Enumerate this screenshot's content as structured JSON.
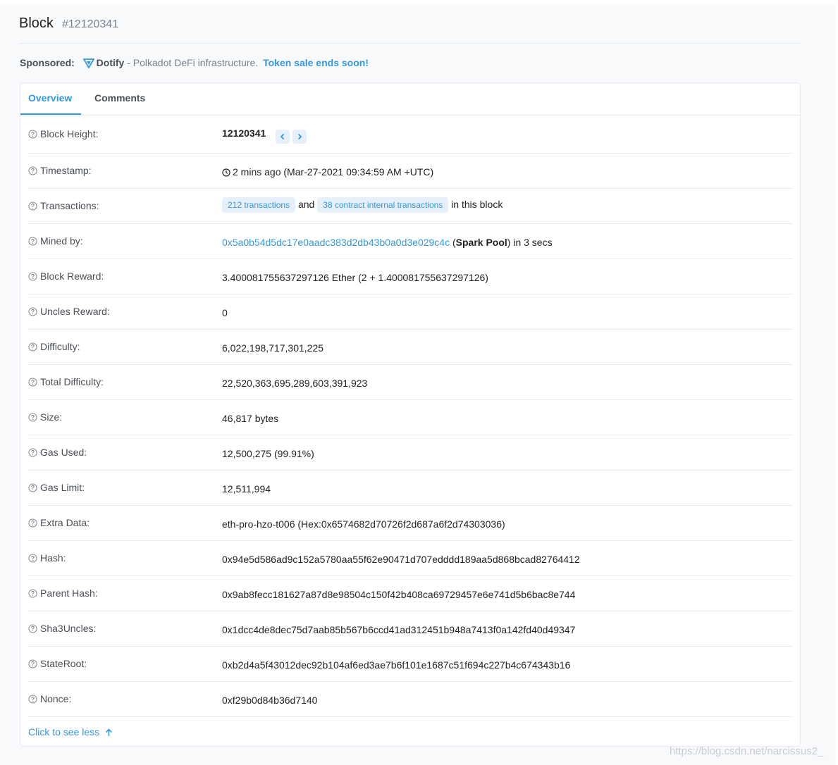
{
  "header": {
    "title": "Block",
    "block_number": "#12120341"
  },
  "sponsor": {
    "label": "Sponsored:",
    "brand": "Dotify",
    "text": "- Polkadot DeFi infrastructure.",
    "cta": "Token sale ends soon!"
  },
  "tabs": [
    {
      "label": "Overview",
      "active": true
    },
    {
      "label": "Comments",
      "active": false
    }
  ],
  "overview": {
    "block_height": {
      "label": "Block Height:",
      "value": "12120341"
    },
    "timestamp": {
      "label": "Timestamp:",
      "value": "2 mins ago (Mar-27-2021 09:34:59 AM +UTC)"
    },
    "transactions": {
      "label": "Transactions:",
      "tx_badge": "212 transactions",
      "and": "and",
      "internal_badge": "38 contract internal transactions",
      "suffix": "in this block"
    },
    "mined_by": {
      "label": "Mined by:",
      "address": "0x5a0b54d5dc17e0aadc383d2db43b0a0d3e029c4c",
      "open_paren": "(",
      "pool": "Spark Pool",
      "suffix": ") in 3 secs"
    },
    "block_reward": {
      "label": "Block Reward:",
      "value": "3.400081755637297126 Ether (2 + 1.400081755637297126)"
    },
    "uncles_reward": {
      "label": "Uncles Reward:",
      "value": "0"
    },
    "difficulty": {
      "label": "Difficulty:",
      "value": "6,022,198,717,301,225"
    },
    "total_difficulty": {
      "label": "Total Difficulty:",
      "value": "22,520,363,695,289,603,391,923"
    },
    "size": {
      "label": "Size:",
      "value": "46,817 bytes"
    },
    "gas_used": {
      "label": "Gas Used:",
      "value": "12,500,275 (99.91%)"
    },
    "gas_limit": {
      "label": "Gas Limit:",
      "value": "12,511,994"
    },
    "extra_data": {
      "label": "Extra Data:",
      "value": "eth-pro-hzo-t006 (Hex:0x6574682d70726f2d687a6f2d74303036)"
    },
    "hash": {
      "label": "Hash:",
      "value": "0x94e5d586ad9c152a5780aa55f62e90471d707edddd189aa5d868bcad82764412"
    },
    "parent_hash": {
      "label": "Parent Hash:",
      "value": "0x9ab8fecc181627a87d8e98504c150f42b408ca69729457e6e741d5b6bac8e744"
    },
    "sha3uncles": {
      "label": "Sha3Uncles:",
      "value": "0x1dcc4de8dec75d7aab85b567b6ccd41ad312451b948a7413f0a142fd40d49347"
    },
    "stateroot": {
      "label": "StateRoot:",
      "value": "0xb2d4a5f43012dec92b104af6ed3ae7b6f101e1687c51f694c227b4c674343b16"
    },
    "nonce": {
      "label": "Nonce:",
      "value": "0xf29b0d84b36d7140"
    }
  },
  "toggle": {
    "label": "Click to see less"
  },
  "watermark": "https://blog.csdn.net/narcissus2_",
  "colors": {
    "accent": "#3498db",
    "text": "#1e2022",
    "muted": "#77838f",
    "badge_bg": "#e6f0fa"
  },
  "icons": [
    "dotify-logo-icon",
    "question-circle-icon",
    "chevron-left-icon",
    "chevron-right-icon",
    "clock-icon",
    "arrow-up-icon"
  ]
}
